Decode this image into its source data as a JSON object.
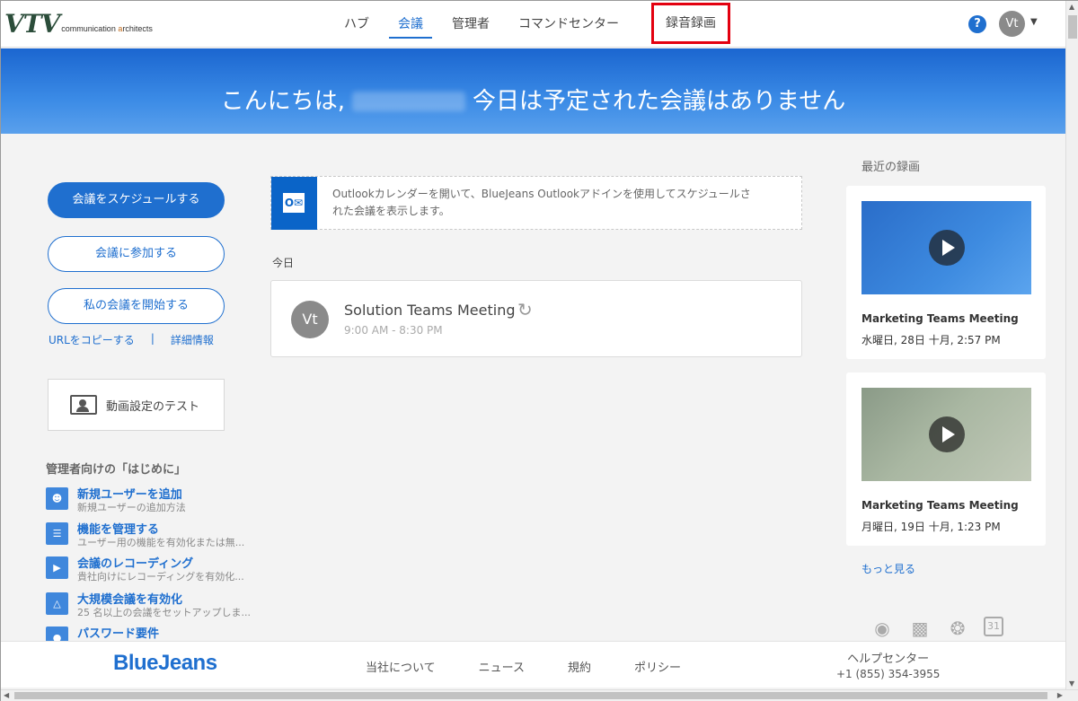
{
  "header": {
    "logo_text": "VTV",
    "logo_tagline_part1": "communication ",
    "logo_tagline_part2": "a",
    "logo_tagline_part3": "rchitects",
    "nav": [
      {
        "label": "ハブ",
        "active": false
      },
      {
        "label": "会議",
        "active": true
      },
      {
        "label": "管理者",
        "active": false
      },
      {
        "label": "コマンドセンター",
        "active": false
      },
      {
        "label": "録音録画",
        "active": false,
        "highlighted": true
      }
    ],
    "help_icon": "?",
    "avatar_initials": "Vt",
    "dropdown_icon": "chevron-down"
  },
  "banner": {
    "greeting": "こんにちは,",
    "message": "今日は予定された会議はありません"
  },
  "left": {
    "schedule_button": "会議をスケジュールする",
    "join_button": "会議に参加する",
    "start_button": "私の会議を開始する",
    "copy_url_link": "URLをコピーする",
    "separator": "|",
    "details_link": "詳細情報",
    "video_test": "動画設定のテスト",
    "admin_title": "管理者向けの「はじめに」",
    "admin_items": [
      {
        "title": "新規ユーザーを追加",
        "subtitle": "新規ユーザーの追加方法",
        "icon": "user-add-icon"
      },
      {
        "title": "機能を管理する",
        "subtitle": "ユーザー用の機能を有効化または無...",
        "icon": "features-icon"
      },
      {
        "title": "会議のレコーディング",
        "subtitle": "貴社向けにレコーディングを有効化...",
        "icon": "camera-icon"
      },
      {
        "title": "大規模会議を有効化",
        "subtitle": "25 名以上の会議をセットアップしま...",
        "icon": "large-meeting-icon"
      },
      {
        "title": "パスワード要件",
        "subtitle": "",
        "icon": "lock-icon"
      }
    ]
  },
  "center": {
    "outlook_text": "Outlookカレンダーを開いて、BlueJeans Outlookアドインを使用してスケジュールされた会議を表示します。",
    "today_label": "今日",
    "meeting": {
      "avatar": "Vt",
      "title": "Solution Teams Meeting",
      "time": "9:00 AM - 8:30 PM"
    }
  },
  "right": {
    "recent_title": "最近の録画",
    "recordings": [
      {
        "title": "Marketing Teams Meeting",
        "date": "水曜日, 28日 十月, 2:57 PM"
      },
      {
        "title": "Marketing Teams Meeting",
        "date": "月曜日, 19日 十月, 1:23 PM"
      }
    ],
    "more_link": "もっと見る",
    "platform_icons": [
      "apple-icon",
      "android-icon",
      "safari-icon",
      "calendar-icon"
    ],
    "calendar_day": "31"
  },
  "footer": {
    "brand": "BlueJeans",
    "links": [
      "当社について",
      "ニュース",
      "規約",
      "ポリシー"
    ],
    "help_center": "ヘルプセンター",
    "phone": "+1 (855) 354-3955"
  },
  "colors": {
    "accent": "#1f6fcf",
    "highlight": "#e3000f"
  }
}
